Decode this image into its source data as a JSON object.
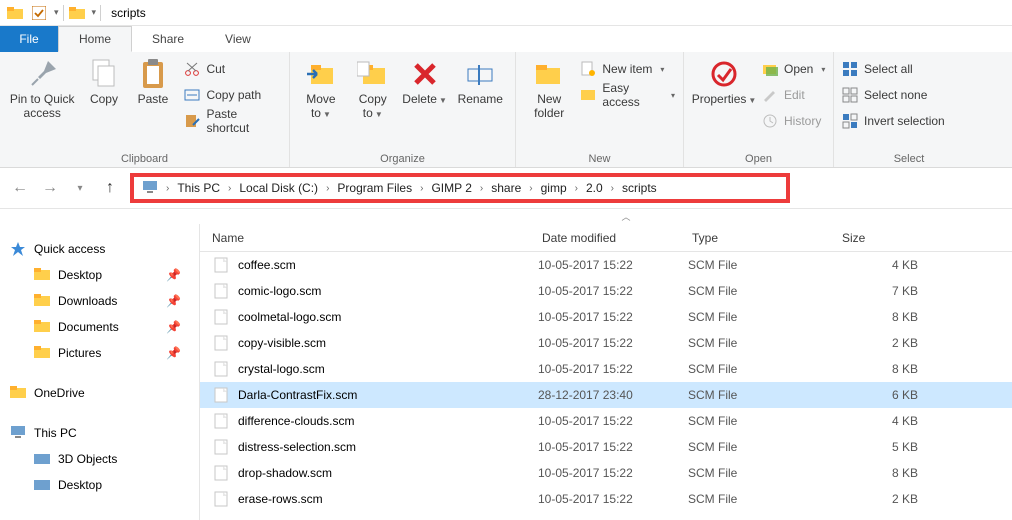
{
  "title": "scripts",
  "tabs": {
    "file": "File",
    "home": "Home",
    "share": "Share",
    "view": "View"
  },
  "ribbon": {
    "clipboard": {
      "label": "Clipboard",
      "pin": "Pin to Quick access",
      "copy": "Copy",
      "paste": "Paste",
      "cut": "Cut",
      "copypath": "Copy path",
      "pasteshort": "Paste shortcut"
    },
    "organize": {
      "label": "Organize",
      "moveto": "Move to",
      "copyto": "Copy to",
      "delete": "Delete",
      "rename": "Rename"
    },
    "new": {
      "label": "New",
      "newfolder": "New folder",
      "newitem": "New item",
      "easyaccess": "Easy access"
    },
    "open": {
      "label": "Open",
      "properties": "Properties",
      "open": "Open",
      "edit": "Edit",
      "history": "History"
    },
    "select": {
      "label": "Select",
      "all": "Select all",
      "none": "Select none",
      "invert": "Invert selection"
    }
  },
  "breadcrumb": [
    "This PC",
    "Local Disk (C:)",
    "Program Files",
    "GIMP 2",
    "share",
    "gimp",
    "2.0",
    "scripts"
  ],
  "sidebar": {
    "quick": "Quick access",
    "items": [
      {
        "label": "Desktop"
      },
      {
        "label": "Downloads"
      },
      {
        "label": "Documents"
      },
      {
        "label": "Pictures"
      }
    ],
    "onedrive": "OneDrive",
    "thispc": "This PC",
    "pcitems": [
      {
        "label": "3D Objects"
      },
      {
        "label": "Desktop"
      }
    ]
  },
  "columns": {
    "name": "Name",
    "date": "Date modified",
    "type": "Type",
    "size": "Size"
  },
  "files": [
    {
      "name": "coffee.scm",
      "date": "10-05-2017 15:22",
      "type": "SCM File",
      "size": "4 KB",
      "sel": false
    },
    {
      "name": "comic-logo.scm",
      "date": "10-05-2017 15:22",
      "type": "SCM File",
      "size": "7 KB",
      "sel": false
    },
    {
      "name": "coolmetal-logo.scm",
      "date": "10-05-2017 15:22",
      "type": "SCM File",
      "size": "8 KB",
      "sel": false
    },
    {
      "name": "copy-visible.scm",
      "date": "10-05-2017 15:22",
      "type": "SCM File",
      "size": "2 KB",
      "sel": false
    },
    {
      "name": "crystal-logo.scm",
      "date": "10-05-2017 15:22",
      "type": "SCM File",
      "size": "8 KB",
      "sel": false
    },
    {
      "name": "Darla-ContrastFix.scm",
      "date": "28-12-2017 23:40",
      "type": "SCM File",
      "size": "6 KB",
      "sel": true
    },
    {
      "name": "difference-clouds.scm",
      "date": "10-05-2017 15:22",
      "type": "SCM File",
      "size": "4 KB",
      "sel": false
    },
    {
      "name": "distress-selection.scm",
      "date": "10-05-2017 15:22",
      "type": "SCM File",
      "size": "5 KB",
      "sel": false
    },
    {
      "name": "drop-shadow.scm",
      "date": "10-05-2017 15:22",
      "type": "SCM File",
      "size": "8 KB",
      "sel": false
    },
    {
      "name": "erase-rows.scm",
      "date": "10-05-2017 15:22",
      "type": "SCM File",
      "size": "2 KB",
      "sel": false
    }
  ]
}
